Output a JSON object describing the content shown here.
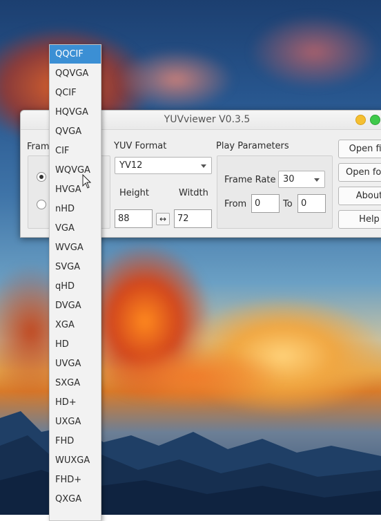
{
  "window": {
    "title": "YUVviewer V0.3.5"
  },
  "frame_size": {
    "label": "Fram",
    "dropdown_items": [
      "QQCIF",
      "QQVGA",
      "QCIF",
      "HQVGA",
      "QVGA",
      "CIF",
      "WQVGA",
      "HVGA",
      "nHD",
      "VGA",
      "WVGA",
      "SVGA",
      "qHD",
      "DVGA",
      "XGA",
      "HD",
      "UVGA",
      "SXGA",
      "HD+",
      "UXGA",
      "FHD",
      "WUXGA",
      "FHD+",
      "QXGA"
    ],
    "selected_item": "QQCIF",
    "hovered_item": "WQVGA"
  },
  "yuv_format": {
    "label": "YUV Format",
    "value": "YV12",
    "height_label": "Height",
    "width_label": "Witdth",
    "height_value": "88",
    "width_value": "72",
    "swap_symbol": "↔"
  },
  "play": {
    "label": "Play Parameters",
    "frame_rate_label": "Frame Rate",
    "frame_rate_value": "30",
    "from_label": "From",
    "from_value": "0",
    "to_label": "To",
    "to_value": "0"
  },
  "buttons": {
    "open_file": "Open file",
    "open_folder": "Open folder",
    "about": "About",
    "help": "Help"
  },
  "colors": {
    "selection": "#3b8fd4",
    "minimize": "#f5bf31",
    "maximize": "#3fc94a"
  }
}
